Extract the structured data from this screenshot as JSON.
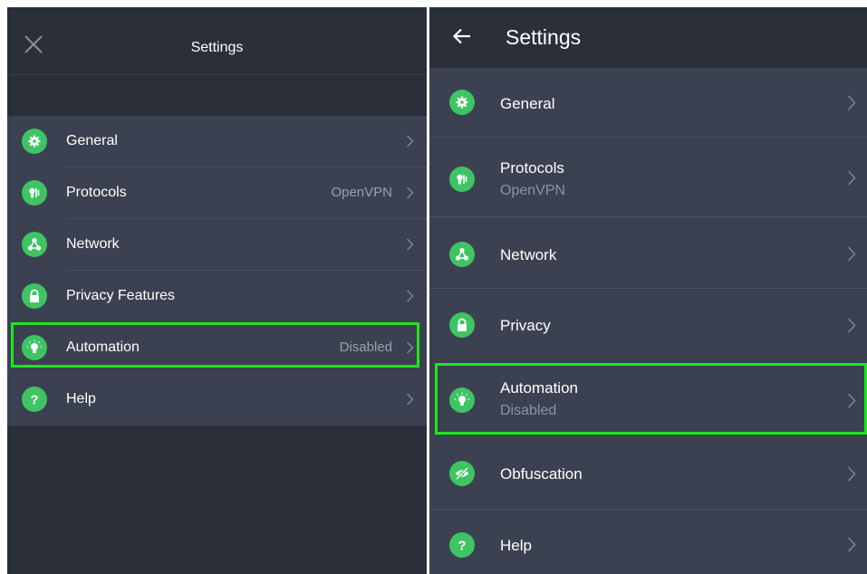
{
  "left_panel": {
    "title": "Settings",
    "items": [
      {
        "label": "General",
        "value": ""
      },
      {
        "label": "Protocols",
        "value": "OpenVPN"
      },
      {
        "label": "Network",
        "value": ""
      },
      {
        "label": "Privacy Features",
        "value": ""
      },
      {
        "label": "Automation",
        "value": "Disabled"
      },
      {
        "label": "Help",
        "value": ""
      }
    ]
  },
  "right_panel": {
    "title": "Settings",
    "items": [
      {
        "label": "General",
        "subtitle": ""
      },
      {
        "label": "Protocols",
        "subtitle": "OpenVPN"
      },
      {
        "label": "Network",
        "subtitle": ""
      },
      {
        "label": "Privacy",
        "subtitle": ""
      },
      {
        "label": "Automation",
        "subtitle": "Disabled"
      },
      {
        "label": "Obfuscation",
        "subtitle": ""
      },
      {
        "label": "Help",
        "subtitle": ""
      }
    ]
  },
  "icons": {
    "general": "gear-icon",
    "protocols": "protocol-icon",
    "network": "network-icon",
    "privacy": "lock-icon",
    "automation": "lightbulb-icon",
    "obfuscation": "eye-slash-icon",
    "help": "question-icon"
  },
  "colors": {
    "accent_green": "#3ec463",
    "highlight_green": "#1fe61f",
    "header_bg": "#2b2f3a",
    "row_bg": "#3b4150",
    "muted_text": "#9aa0ab"
  }
}
